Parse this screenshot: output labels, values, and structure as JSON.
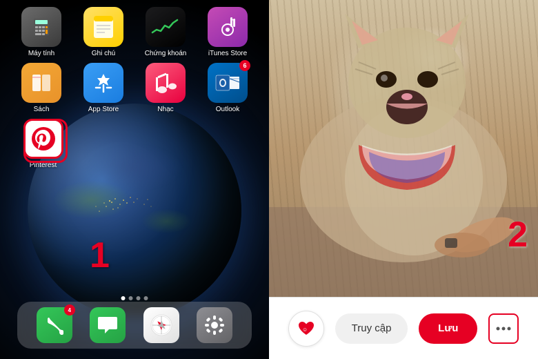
{
  "left": {
    "apps_row1": [
      {
        "id": "calculator",
        "label": "Máy tính",
        "icon_type": "calculator"
      },
      {
        "id": "notes",
        "label": "Ghi chú",
        "icon_type": "notes"
      },
      {
        "id": "stocks",
        "label": "Chứng khoán",
        "icon_type": "stocks"
      },
      {
        "id": "itunes",
        "label": "iTunes Store",
        "icon_type": "itunes",
        "badge": ""
      }
    ],
    "apps_row2": [
      {
        "id": "books",
        "label": "Sách",
        "icon_type": "books"
      },
      {
        "id": "appstore",
        "label": "App Store",
        "icon_type": "appstore"
      },
      {
        "id": "music",
        "label": "Nhạc",
        "icon_type": "music"
      },
      {
        "id": "outlook",
        "label": "Outlook",
        "icon_type": "outlook",
        "badge": "6"
      }
    ],
    "apps_row3": [
      {
        "id": "pinterest",
        "label": "Pinterest",
        "icon_type": "pinterest",
        "highlighted": true
      }
    ],
    "step_label": "1",
    "dock": [
      {
        "id": "phone",
        "icon_type": "phone",
        "badge": "4"
      },
      {
        "id": "messages",
        "icon_type": "messages"
      },
      {
        "id": "safari",
        "icon_type": "safari"
      },
      {
        "id": "settings",
        "icon_type": "settings"
      }
    ]
  },
  "right": {
    "step_label": "2",
    "action_bar": {
      "heart_icon": "♥",
      "truy_cap_label": "Truy cập",
      "luu_label": "Lưu",
      "more_icon": "···"
    }
  }
}
